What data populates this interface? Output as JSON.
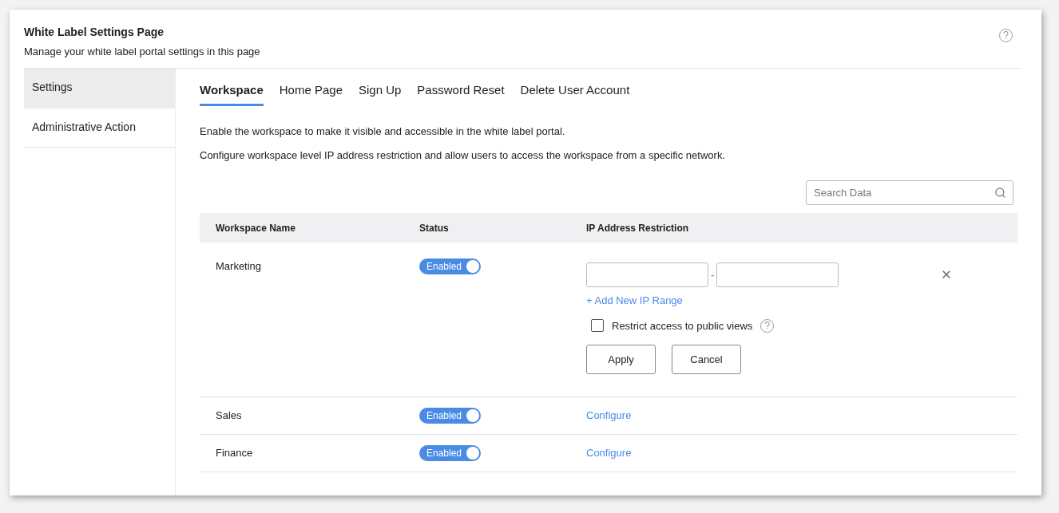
{
  "header": {
    "title": "White Label Settings Page",
    "subtitle": "Manage your white label portal settings in this page"
  },
  "sidebar": {
    "items": [
      {
        "label": "Settings",
        "selected": true
      },
      {
        "label": "Administrative Action",
        "selected": false
      }
    ]
  },
  "tabs": [
    {
      "label": "Workspace",
      "selected": true
    },
    {
      "label": "Home Page",
      "selected": false
    },
    {
      "label": "Sign Up",
      "selected": false
    },
    {
      "label": "Password Reset",
      "selected": false
    },
    {
      "label": "Delete User Account",
      "selected": false
    }
  ],
  "description": [
    "Enable the workspace to make it visible and accessible in the white label portal.",
    "Configure workspace level IP address restriction and allow users to access the workspace from a specific network."
  ],
  "search": {
    "placeholder": "Search Data"
  },
  "table": {
    "columns": [
      "Workspace Name",
      "Status",
      "IP Address Restriction"
    ],
    "rows": [
      {
        "name": "Marketing",
        "status": {
          "label": "Enabled",
          "on": true
        },
        "kind": "editor",
        "ip": {
          "separator": "-",
          "add_link": "+ Add New IP Range",
          "restrict": {
            "label": "Restrict access to public views",
            "checked": false
          },
          "buttons": [
            "Apply",
            "Cancel"
          ]
        }
      },
      {
        "name": "Sales",
        "status": {
          "label": "Enabled",
          "on": true
        },
        "kind": "link",
        "link": "Configure"
      },
      {
        "name": "Finance",
        "status": {
          "label": "Enabled",
          "on": true
        },
        "kind": "link",
        "link": "Configure"
      }
    ]
  }
}
